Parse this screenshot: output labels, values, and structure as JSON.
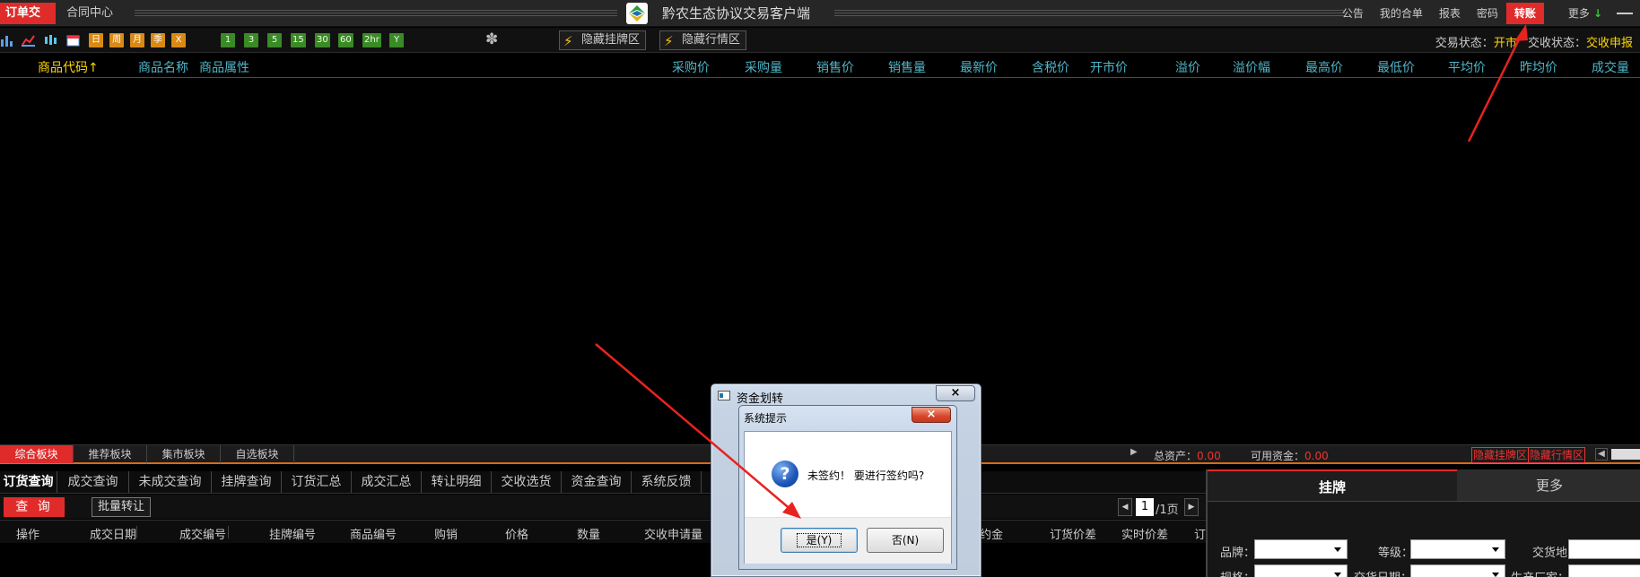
{
  "titlebar": {
    "tab_order": "订单交易",
    "tab_contract": "合同中心",
    "app_title": "黔农生态协议交易客户端",
    "nav": [
      "公告",
      "我的合单",
      "报表",
      "密码",
      "转账",
      "更多"
    ],
    "nav_more_arrow": "↓",
    "accent": "#e02b2b"
  },
  "toolbar": {
    "periods_orange": [
      "日",
      "周",
      "月",
      "季",
      "X"
    ],
    "periods_green": [
      "1",
      "3",
      "5",
      "15",
      "30",
      "60",
      "2hr",
      "Y"
    ],
    "hide_list_label": "隐藏挂牌区",
    "hide_market_label": "隐藏行情区",
    "status": {
      "trade_label": "交易状态：",
      "trade_value": "开市",
      "delivery_label": "交收状态：",
      "delivery_value": "交收申报"
    }
  },
  "main_table": {
    "headers": [
      "商品代码↑",
      "商品名称",
      "商品属性",
      "采购价",
      "采购量",
      "销售价",
      "销售量",
      "最新价",
      "含税价",
      "开市价",
      "溢价",
      "溢价幅",
      "最高价",
      "最低价",
      "平均价",
      "昨均价",
      "成交量"
    ]
  },
  "board_bar": {
    "tabs": [
      "综合板块",
      "推荐板块",
      "集市板块",
      "自选板块"
    ],
    "total_assets_label": "总资产：",
    "total_assets_value": "0.00",
    "available_label": "可用资金：",
    "available_value": "0.00",
    "hide_list_mini": "隐藏挂牌区",
    "hide_market_mini": "隐藏行情区"
  },
  "query": {
    "tabs": [
      "订货查询",
      "成交查询",
      "未成交查询",
      "挂牌查询",
      "订货汇总",
      "成交汇总",
      "转让明细",
      "交收选货",
      "资金查询",
      "系统反馈"
    ],
    "query_button": "查 询",
    "batch_transfer_button": "批量转让",
    "page_current": "1",
    "page_total": "/1页",
    "headers": [
      "操作",
      "成交日期",
      "成交编号",
      "挂牌编号",
      "商品编号",
      "购销",
      "价格",
      "数量",
      "交收申请量",
      "约金",
      "订货价差",
      "实时价差",
      "订"
    ]
  },
  "right_panel": {
    "tab_list": "挂牌",
    "tab_more": "更多",
    "fields": [
      "品牌：",
      "等级：",
      "交货地：",
      "规格：",
      "交货日期：",
      "生产厂家："
    ]
  },
  "outer_dialog": {
    "title": "资金划转",
    "close": "×"
  },
  "inner_dialog": {
    "title": "系统提示",
    "close": "×",
    "icon": "?",
    "message": "未签约！ 要进行签约吗?",
    "yes_label": "是(Y)",
    "no_label": "否(N)"
  }
}
